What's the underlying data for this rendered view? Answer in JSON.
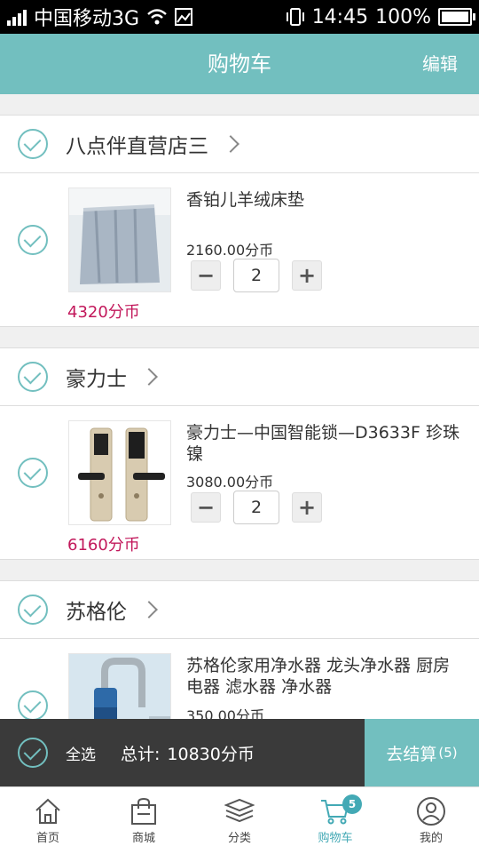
{
  "status_bar": {
    "carrier": "中国移动3G",
    "time": "14:45",
    "battery": "100%",
    "battery_level": 1.0
  },
  "header": {
    "title": "购物车",
    "edit_label": "编辑"
  },
  "stores": [
    {
      "name": "八点伴直营店三",
      "items": [
        {
          "name": "香铂儿羊绒床垫",
          "price": "2160.00分币",
          "qty": "2",
          "total": "4320分币",
          "image": "mattress-photo"
        }
      ]
    },
    {
      "name": "豪力士",
      "items": [
        {
          "name": "豪力士—中国智能锁—D3633F 珍珠镍",
          "price": "3080.00分币",
          "qty": "2",
          "total": "6160分币",
          "image": "smart-lock-photo"
        }
      ]
    },
    {
      "name": "苏格伦",
      "items": [
        {
          "name": "苏格伦家用净水器 龙头净水器 厨房电器 滤水器 净水器",
          "price": "350.00分币",
          "qty": "",
          "total": "",
          "image": "water-purifier-photo"
        }
      ]
    }
  ],
  "stepper": {
    "minus": "−",
    "plus": "+"
  },
  "footer": {
    "select_all": "全选",
    "total_label": "总计:",
    "total_value": "10830分币",
    "checkout_label": "去结算",
    "checkout_count": "(5)"
  },
  "tabbar": {
    "tabs": [
      {
        "label": "首页",
        "icon": "home-icon"
      },
      {
        "label": "商城",
        "icon": "shopping-bag-icon"
      },
      {
        "label": "分类",
        "icon": "layers-icon"
      },
      {
        "label": "购物车",
        "icon": "cart-icon",
        "badge": "5",
        "active": true
      },
      {
        "label": "我的",
        "icon": "user-icon"
      }
    ]
  },
  "colors": {
    "accent": "#72bfbf",
    "price_red": "#c2185b",
    "footer_bg": "#3a3a3a"
  }
}
